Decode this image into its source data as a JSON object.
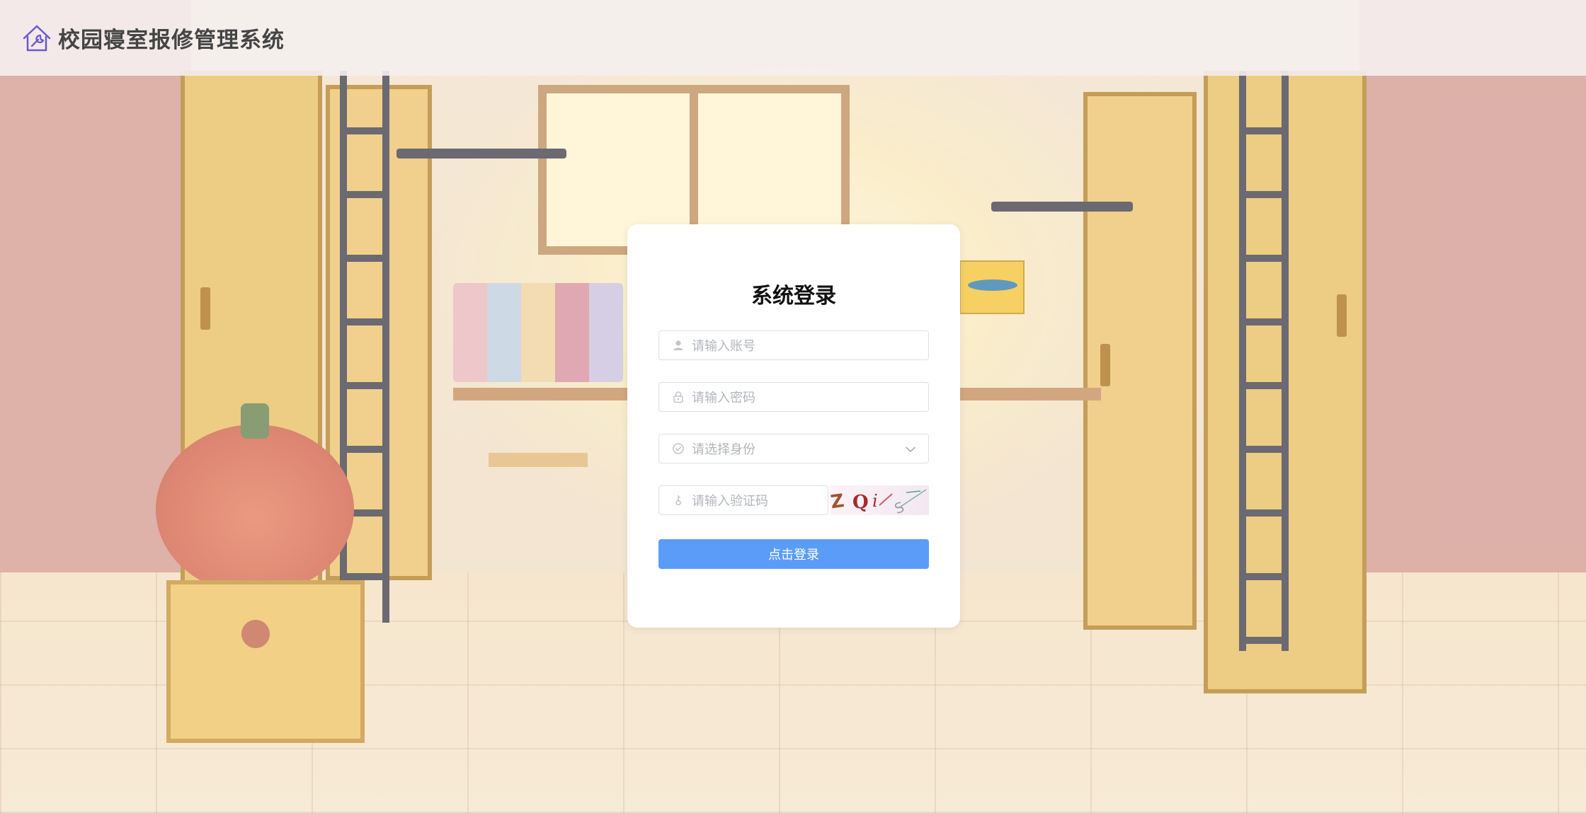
{
  "header": {
    "title": "校园寝室报修管理系统",
    "logo_icon": "house-wrench-icon"
  },
  "login": {
    "title": "系统登录",
    "username_placeholder": "请输入账号",
    "password_placeholder": "请输入密码",
    "role_placeholder": "请选择身份",
    "captcha_placeholder": "请输入验证码",
    "captcha_text": "ZQi S",
    "submit_label": "点击登录"
  },
  "colors": {
    "primary_button": "#5b9cf8",
    "header_text": "#444444",
    "placeholder_text": "#b2b5bb",
    "input_border": "#dcdfe6"
  }
}
